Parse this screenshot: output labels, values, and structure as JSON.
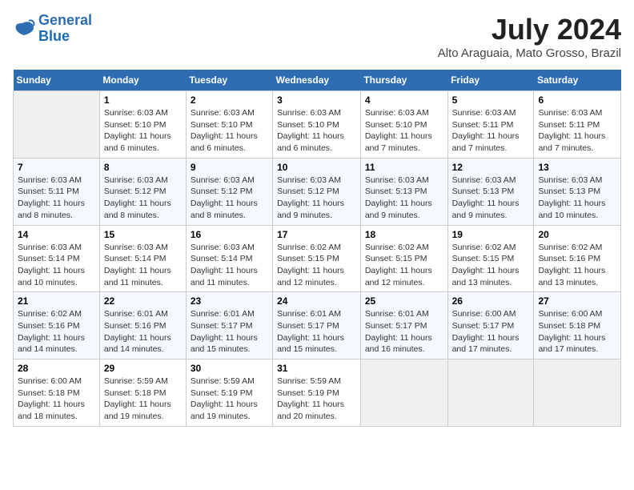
{
  "logo": {
    "line1": "General",
    "line2": "Blue"
  },
  "title": "July 2024",
  "subtitle": "Alto Araguaia, Mato Grosso, Brazil",
  "weekdays": [
    "Sunday",
    "Monday",
    "Tuesday",
    "Wednesday",
    "Thursday",
    "Friday",
    "Saturday"
  ],
  "weeks": [
    [
      {
        "day": "",
        "info": ""
      },
      {
        "day": "1",
        "info": "Sunrise: 6:03 AM\nSunset: 5:10 PM\nDaylight: 11 hours\nand 6 minutes."
      },
      {
        "day": "2",
        "info": "Sunrise: 6:03 AM\nSunset: 5:10 PM\nDaylight: 11 hours\nand 6 minutes."
      },
      {
        "day": "3",
        "info": "Sunrise: 6:03 AM\nSunset: 5:10 PM\nDaylight: 11 hours\nand 6 minutes."
      },
      {
        "day": "4",
        "info": "Sunrise: 6:03 AM\nSunset: 5:10 PM\nDaylight: 11 hours\nand 7 minutes."
      },
      {
        "day": "5",
        "info": "Sunrise: 6:03 AM\nSunset: 5:11 PM\nDaylight: 11 hours\nand 7 minutes."
      },
      {
        "day": "6",
        "info": "Sunrise: 6:03 AM\nSunset: 5:11 PM\nDaylight: 11 hours\nand 7 minutes."
      }
    ],
    [
      {
        "day": "7",
        "info": "Sunrise: 6:03 AM\nSunset: 5:11 PM\nDaylight: 11 hours\nand 8 minutes."
      },
      {
        "day": "8",
        "info": "Sunrise: 6:03 AM\nSunset: 5:12 PM\nDaylight: 11 hours\nand 8 minutes."
      },
      {
        "day": "9",
        "info": "Sunrise: 6:03 AM\nSunset: 5:12 PM\nDaylight: 11 hours\nand 8 minutes."
      },
      {
        "day": "10",
        "info": "Sunrise: 6:03 AM\nSunset: 5:12 PM\nDaylight: 11 hours\nand 9 minutes."
      },
      {
        "day": "11",
        "info": "Sunrise: 6:03 AM\nSunset: 5:13 PM\nDaylight: 11 hours\nand 9 minutes."
      },
      {
        "day": "12",
        "info": "Sunrise: 6:03 AM\nSunset: 5:13 PM\nDaylight: 11 hours\nand 9 minutes."
      },
      {
        "day": "13",
        "info": "Sunrise: 6:03 AM\nSunset: 5:13 PM\nDaylight: 11 hours\nand 10 minutes."
      }
    ],
    [
      {
        "day": "14",
        "info": "Sunrise: 6:03 AM\nSunset: 5:14 PM\nDaylight: 11 hours\nand 10 minutes."
      },
      {
        "day": "15",
        "info": "Sunrise: 6:03 AM\nSunset: 5:14 PM\nDaylight: 11 hours\nand 11 minutes."
      },
      {
        "day": "16",
        "info": "Sunrise: 6:03 AM\nSunset: 5:14 PM\nDaylight: 11 hours\nand 11 minutes."
      },
      {
        "day": "17",
        "info": "Sunrise: 6:02 AM\nSunset: 5:15 PM\nDaylight: 11 hours\nand 12 minutes."
      },
      {
        "day": "18",
        "info": "Sunrise: 6:02 AM\nSunset: 5:15 PM\nDaylight: 11 hours\nand 12 minutes."
      },
      {
        "day": "19",
        "info": "Sunrise: 6:02 AM\nSunset: 5:15 PM\nDaylight: 11 hours\nand 13 minutes."
      },
      {
        "day": "20",
        "info": "Sunrise: 6:02 AM\nSunset: 5:16 PM\nDaylight: 11 hours\nand 13 minutes."
      }
    ],
    [
      {
        "day": "21",
        "info": "Sunrise: 6:02 AM\nSunset: 5:16 PM\nDaylight: 11 hours\nand 14 minutes."
      },
      {
        "day": "22",
        "info": "Sunrise: 6:01 AM\nSunset: 5:16 PM\nDaylight: 11 hours\nand 14 minutes."
      },
      {
        "day": "23",
        "info": "Sunrise: 6:01 AM\nSunset: 5:17 PM\nDaylight: 11 hours\nand 15 minutes."
      },
      {
        "day": "24",
        "info": "Sunrise: 6:01 AM\nSunset: 5:17 PM\nDaylight: 11 hours\nand 15 minutes."
      },
      {
        "day": "25",
        "info": "Sunrise: 6:01 AM\nSunset: 5:17 PM\nDaylight: 11 hours\nand 16 minutes."
      },
      {
        "day": "26",
        "info": "Sunrise: 6:00 AM\nSunset: 5:17 PM\nDaylight: 11 hours\nand 17 minutes."
      },
      {
        "day": "27",
        "info": "Sunrise: 6:00 AM\nSunset: 5:18 PM\nDaylight: 11 hours\nand 17 minutes."
      }
    ],
    [
      {
        "day": "28",
        "info": "Sunrise: 6:00 AM\nSunset: 5:18 PM\nDaylight: 11 hours\nand 18 minutes."
      },
      {
        "day": "29",
        "info": "Sunrise: 5:59 AM\nSunset: 5:18 PM\nDaylight: 11 hours\nand 19 minutes."
      },
      {
        "day": "30",
        "info": "Sunrise: 5:59 AM\nSunset: 5:19 PM\nDaylight: 11 hours\nand 19 minutes."
      },
      {
        "day": "31",
        "info": "Sunrise: 5:59 AM\nSunset: 5:19 PM\nDaylight: 11 hours\nand 20 minutes."
      },
      {
        "day": "",
        "info": ""
      },
      {
        "day": "",
        "info": ""
      },
      {
        "day": "",
        "info": ""
      }
    ]
  ]
}
